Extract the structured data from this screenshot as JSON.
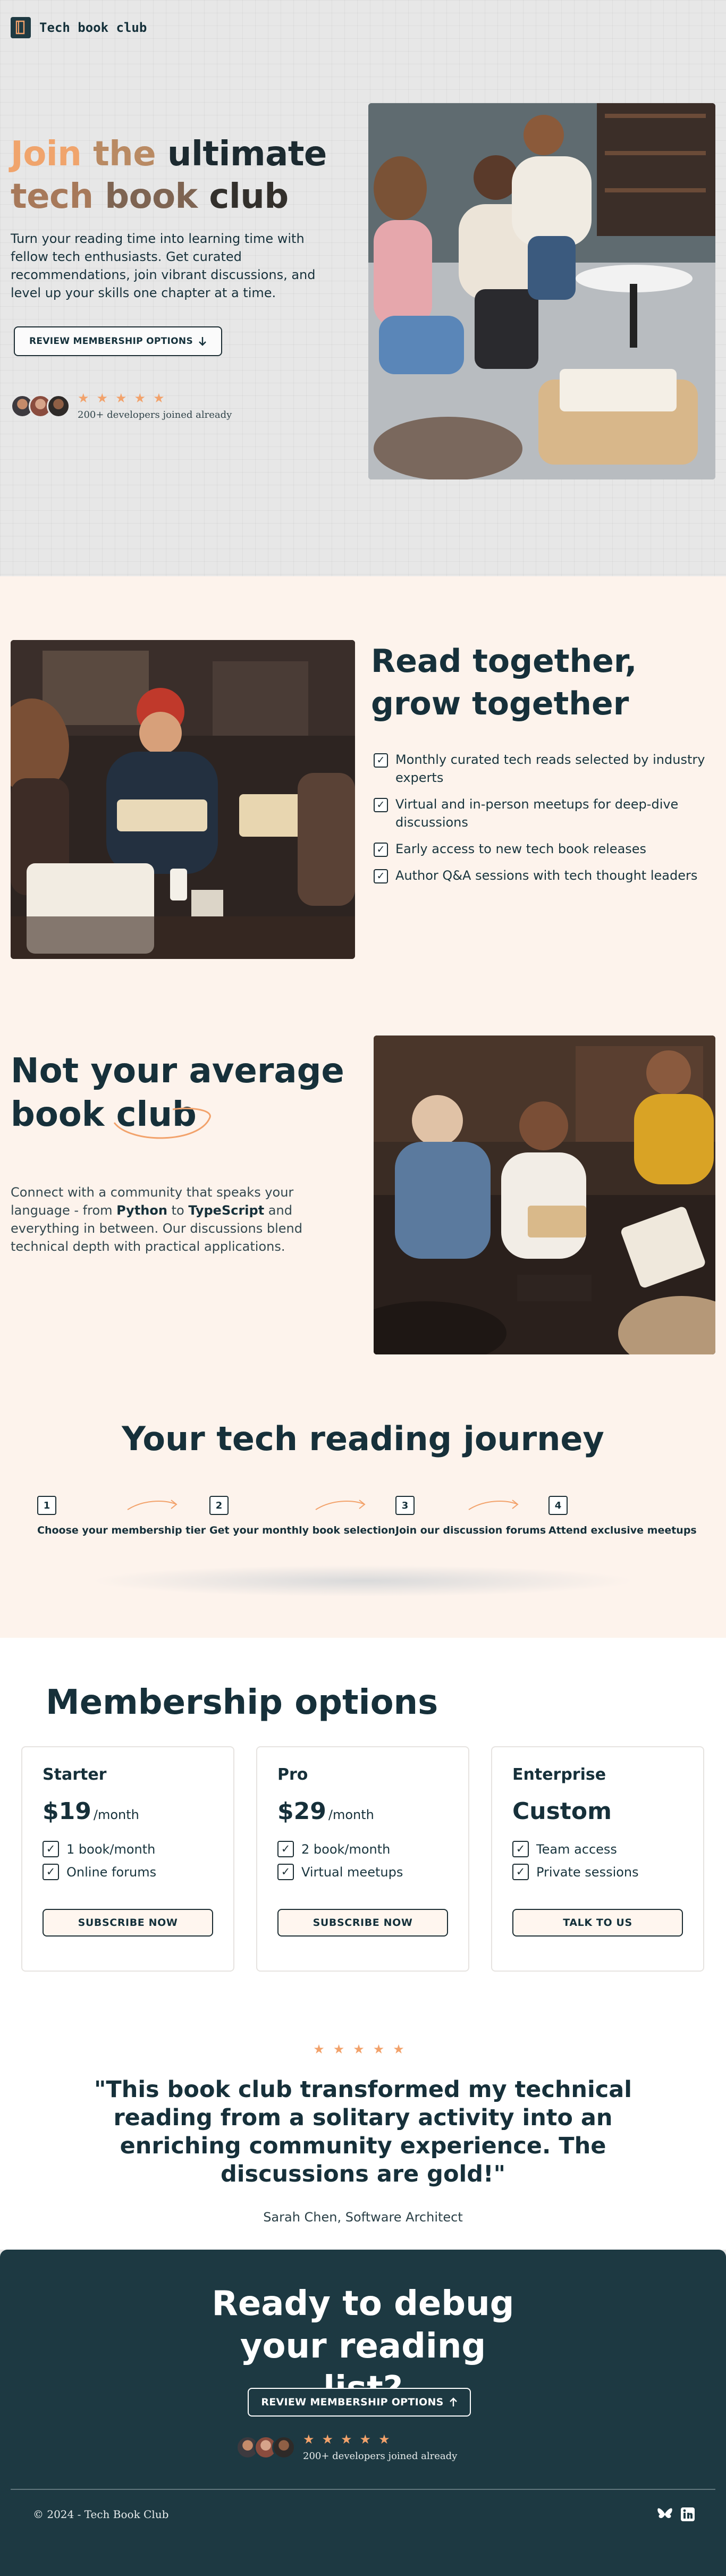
{
  "header": {
    "logo_label": "Tech book club",
    "logo_icon": "book-icon"
  },
  "hero": {
    "title_words": [
      "Join",
      "the",
      "ultimate",
      "tech",
      "book",
      "club"
    ],
    "subtitle": "Turn your reading time into learning time with fellow tech enthusiasts. Get curated recommendations, join vibrant discussions, and level up your skills one chapter at a time.",
    "cta_label": "REVIEW MEMBERSHIP OPTIONS",
    "cta_icon": "arrow-down-icon",
    "stars": "★★★★★",
    "joined_text": "200+ developers joined already"
  },
  "features": {
    "title": "Read together, grow together",
    "items": [
      "Monthly curated tech reads selected by industry experts",
      "Virtual and in-person meetups for deep-dive discussions",
      "Early access to new tech book releases",
      "Author Q&A sessions with tech thought leaders"
    ],
    "title2_part1": "Not your average book",
    "title2_part2": "club",
    "text2": {
      "before": "Connect with a community that speaks your language - from ",
      "lang1": "Python",
      "mid": " to ",
      "lang2": "TypeScript",
      "after": " and everything in between. Our discussions blend technical depth with practical applications."
    }
  },
  "journey": {
    "title": "Your tech reading journey",
    "steps": [
      {
        "num": "1",
        "label": "Choose your membership tier"
      },
      {
        "num": "2",
        "label": "Get your monthly book selection"
      },
      {
        "num": "3",
        "label": "Join our discussion forums"
      },
      {
        "num": "4",
        "label": "Attend exclusive meetups"
      }
    ]
  },
  "membership": {
    "title": "Membership options",
    "plans": [
      {
        "name": "Starter",
        "price": "$19",
        "period": "/month",
        "items": [
          "1 book/month",
          "Online forums"
        ],
        "button": "SUBSCRIBE NOW"
      },
      {
        "name": "Pro",
        "price": "$29",
        "period": "/month",
        "items": [
          "2 book/month",
          "Virtual meetups"
        ],
        "button": "SUBSCRIBE NOW"
      },
      {
        "name": "Enterprise",
        "price": "Custom",
        "period": "",
        "items": [
          "Team access",
          "Private sessions"
        ],
        "button": "TALK TO US"
      }
    ]
  },
  "testimonial": {
    "stars": "★★★★★",
    "quote": "\"This book club transformed my technical reading from a solitary activity into an enriching community experience. The discussions are gold!\"",
    "author": "Sarah Chen, Software Architect"
  },
  "cta": {
    "title": "Ready to debug your reading list?",
    "button_label": "REVIEW MEMBERSHIP OPTIONS",
    "button_icon": "arrow-up-icon",
    "stars": "★★★★★",
    "joined_text": "200+ developers joined already"
  },
  "footer": {
    "copyright": "© 2024 - Tech Book Club",
    "icons": [
      "bluesky-icon",
      "linkedin-icon"
    ]
  },
  "colors": {
    "accent": "#f2a26b",
    "dark": "#1d3942",
    "cream": "#fdf3ec"
  }
}
